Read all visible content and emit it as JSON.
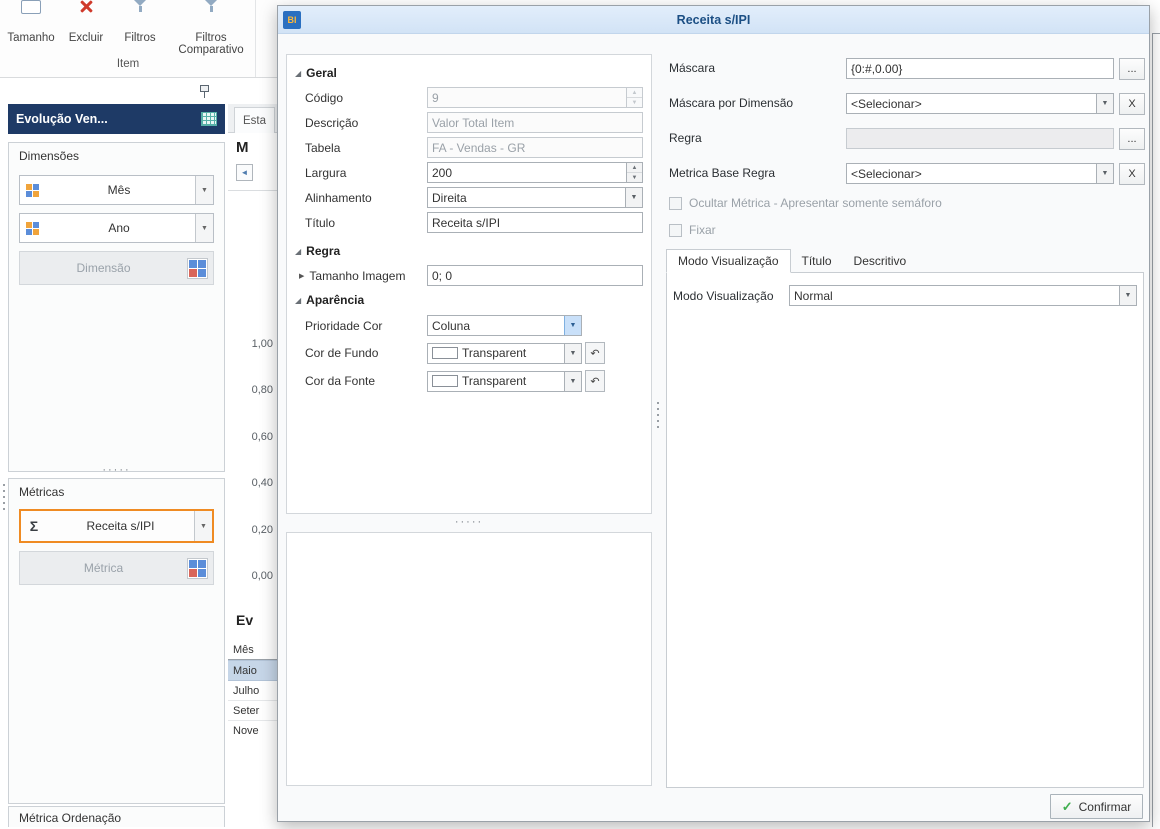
{
  "glyphs": {
    "dropdown": "▼",
    "spin_up": "▲",
    "spin_down": "▼",
    "tri_open": "◢",
    "tri_closed": "▶",
    "nav_left": "◄",
    "sigma": "Σ",
    "check": "✓",
    "undo": "↶",
    "dots": "·····"
  },
  "toolbar": {
    "tamanho": "Tamanho",
    "excluir": "Excluir",
    "filtros": "Filtros",
    "filtros_comp_line1": "Filtros",
    "filtros_comp_line2": "Comparativo",
    "group_label": "Item"
  },
  "sidebar": {
    "panel_title": "Evolução Ven...",
    "dimensoes_header": "Dimensões",
    "dim_items": [
      "Mês",
      "Ano"
    ],
    "dim_placeholder": "Dimensão",
    "metricas_header": "Métricas",
    "metric_label": "Receita s/IPI",
    "metric_placeholder": "Métrica",
    "ordenacao_header": "Métrica Ordenação"
  },
  "backdrop": {
    "tab_label": "Esta",
    "panel_title_partial": "M",
    "axis_labels": [
      "1,00",
      "0,80",
      "0,60",
      "0,40",
      "0,20",
      "0,00"
    ],
    "table_title_partial": "Ev",
    "col_header": "Mês",
    "rows": [
      "Maio",
      "Julho",
      "Seter",
      "Nove"
    ]
  },
  "dialog": {
    "icon_text": "BI",
    "title": "Receita s/IPI",
    "groups": {
      "geral": "Geral",
      "regra": "Regra",
      "aparencia": "Aparência"
    },
    "fields": {
      "codigo_label": "Código",
      "codigo_value": "9",
      "descricao_label": "Descrição",
      "descricao_value": "Valor Total Item",
      "tabela_label": "Tabela",
      "tabela_value": "FA - Vendas - GR",
      "largura_label": "Largura",
      "largura_value": "200",
      "alinhamento_label": "Alinhamento",
      "alinhamento_value": "Direita",
      "titulo_label": "Título",
      "titulo_value": "Receita s/IPI",
      "tamanho_imagem_label": "Tamanho Imagem",
      "tamanho_imagem_value": "0; 0",
      "prioridade_label": "Prioridade Cor",
      "prioridade_value": "Coluna",
      "cor_fundo_label": "Cor de Fundo",
      "cor_fundo_value": "Transparent",
      "cor_fonte_label": "Cor da Fonte",
      "cor_fonte_value": "Transparent"
    },
    "right": {
      "mascara_label": "Máscara",
      "mascara_value": "{0:#,0.00}",
      "mascara_dim_label": "Máscara por Dimensão",
      "mascara_dim_value": "<Selecionar>",
      "regra_label": "Regra",
      "regra_value": "",
      "metrica_base_label": "Metrica Base Regra",
      "metrica_base_value": "<Selecionar>",
      "check_ocultar": "Ocultar Métrica - Apresentar somente semáforo",
      "check_fixar": "Fixar",
      "tabs": [
        "Modo Visualização",
        "Título",
        "Descritivo"
      ],
      "modo_label": "Modo Visualização",
      "modo_value": "Normal",
      "browse_label": "...",
      "clear_label": "X"
    },
    "confirm_label": "Confirmar"
  }
}
